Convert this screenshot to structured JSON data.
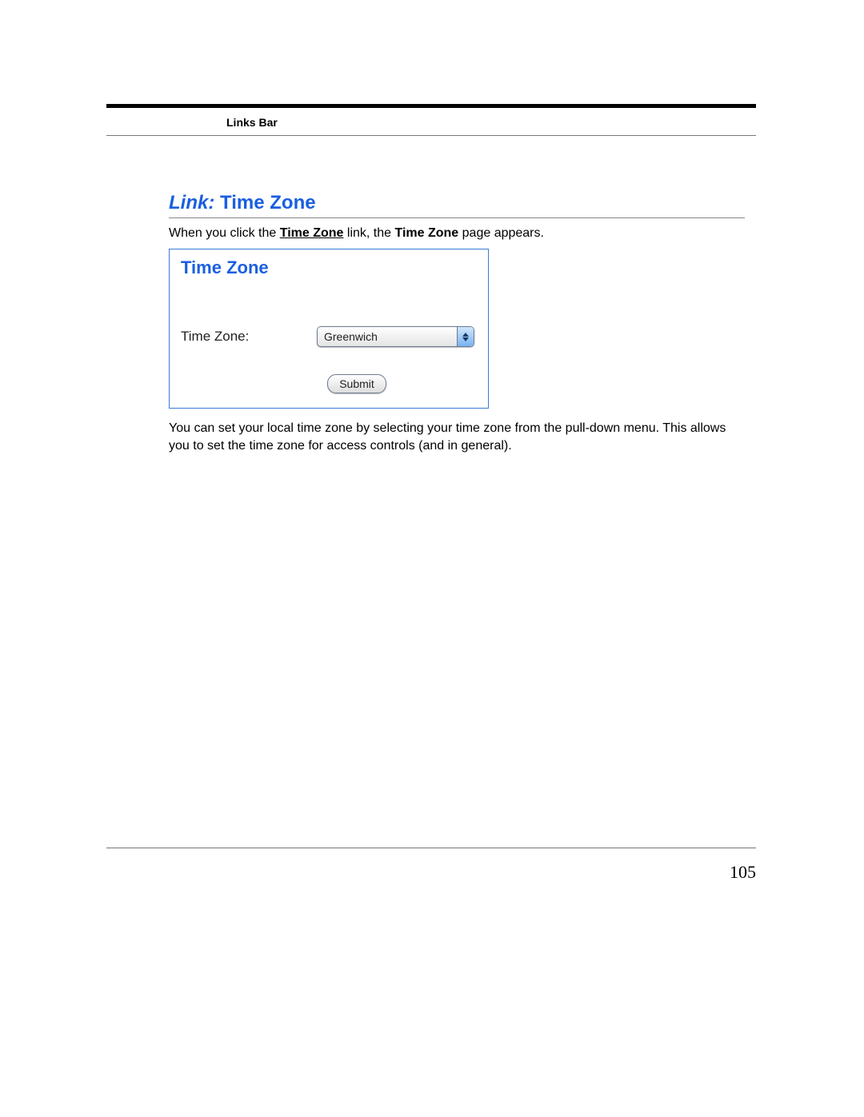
{
  "header": {
    "label": "Links Bar"
  },
  "section": {
    "prefix": "Link:",
    "title": "Time Zone"
  },
  "intro": {
    "pre": "When you click the ",
    "link_text": "Time Zone",
    "mid": " link, the ",
    "page_name": "Time Zone",
    "post": " page appears."
  },
  "panel": {
    "title": "Time Zone",
    "field_label": "Time Zone:",
    "select_value": "Greenwich",
    "submit_label": "Submit"
  },
  "caption": "You can set your local time zone by selecting your time zone from the pull-down menu. This allows you to set the time zone for access controls (and in general).",
  "page_number": "105"
}
